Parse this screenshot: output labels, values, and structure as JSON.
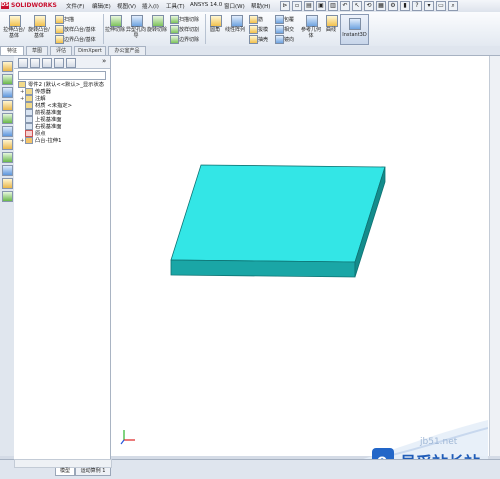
{
  "app": {
    "logo_text": "SOLIDWORKS",
    "logo_mark": "DS"
  },
  "menu": [
    "文件(F)",
    "编辑(E)",
    "视图(V)",
    "插入(I)",
    "工具(T)",
    "ANSYS 14.0",
    "窗口(W)",
    "帮助(H)"
  ],
  "command": {
    "extrude_boss": "拉伸凸台/基体",
    "revolve_boss": "旋转凸台/基体",
    "sweep": "扫描",
    "loft_boss": "放样凸台/基体",
    "boundary_boss": "边界凸台/基体",
    "extrude_cut": "拉伸切除",
    "hole_wizard": "异型孔向导",
    "revolve_cut": "旋转切除",
    "swept_cut": "扫描切除",
    "lofted_cut": "放样切割",
    "boundary_cut": "边界切除",
    "fillet": "圆角",
    "linear_pattern": "线性阵列",
    "rib": "筋",
    "draft": "拔模",
    "shell": "抽壳",
    "wrap": "包覆",
    "intersect": "相交",
    "mirror": "镜向",
    "ref_geometry": "参考几何体",
    "curves": "曲线",
    "instant3d": "Instant3D"
  },
  "tabs": [
    "特征",
    "草图",
    "评估",
    "DimXpert",
    "办公室产品"
  ],
  "feature_tree": {
    "root": "零件2 (默认<<默认>_显示状态",
    "items": [
      {
        "pm": "+",
        "icon": "sensor",
        "label": "传感器"
      },
      {
        "pm": "+",
        "icon": "annotation",
        "label": "注解"
      },
      {
        "pm": "",
        "icon": "material",
        "label": "材质 <未指定>"
      },
      {
        "pm": "",
        "icon": "plane",
        "label": "前视基准面"
      },
      {
        "pm": "",
        "icon": "plane",
        "label": "上视基准面"
      },
      {
        "pm": "",
        "icon": "plane",
        "label": "右视基准面"
      },
      {
        "pm": "",
        "icon": "origin",
        "label": "原点"
      },
      {
        "pm": "+",
        "icon": "extrude",
        "label": "凸台-拉伸1"
      }
    ]
  },
  "bottom_tabs": [
    "模型",
    "运动算例 1"
  ],
  "watermark": {
    "cn": "易采站长站",
    "url": "jb51.net",
    "sub": "www.Easck.Com"
  },
  "colors": {
    "part_top": "#33e6e6",
    "part_front": "#1aa6a6",
    "part_side": "#148c8c",
    "accent": "#1f5cb8"
  }
}
